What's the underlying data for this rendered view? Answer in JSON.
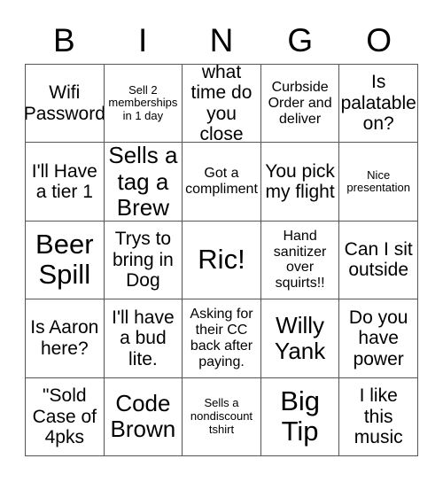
{
  "card": {
    "header_letters": [
      "B",
      "I",
      "N",
      "G",
      "O"
    ],
    "columns": 5,
    "rows": 5,
    "colors": {
      "background": "#ffffff",
      "text": "#000000",
      "grid_line": "#555555"
    },
    "cells": [
      {
        "text": "Wifi Password",
        "size": "md"
      },
      {
        "text": "Sell 2 memberships in 1 day",
        "size": "xs"
      },
      {
        "text": "what time do you close",
        "size": "md"
      },
      {
        "text": "Curbside Order and deliver",
        "size": "sm"
      },
      {
        "text": "Is palatable on?",
        "size": "md"
      },
      {
        "text": "I'll Have a tier 1",
        "size": "md"
      },
      {
        "text": "Sells a tag a Brew",
        "size": "lg"
      },
      {
        "text": "Got a compliment",
        "size": "sm"
      },
      {
        "text": "You pick my flight",
        "size": "md"
      },
      {
        "text": "Nice presentation",
        "size": "xs"
      },
      {
        "text": "Beer Spill",
        "size": "xl"
      },
      {
        "text": "Trys to bring in Dog",
        "size": "md"
      },
      {
        "text": "Ric!",
        "size": "xl"
      },
      {
        "text": "Hand sanitizer over squirts!!",
        "size": "sm"
      },
      {
        "text": "Can I sit outside",
        "size": "md"
      },
      {
        "text": "Is Aaron here?",
        "size": "md"
      },
      {
        "text": "I'll have a bud lite.",
        "size": "md"
      },
      {
        "text": "Asking for their CC back after paying.",
        "size": "sm"
      },
      {
        "text": "Willy Yank",
        "size": "lg"
      },
      {
        "text": "Do you have power",
        "size": "md"
      },
      {
        "text": "\"Sold Case of 4pks",
        "size": "md"
      },
      {
        "text": "Code Brown",
        "size": "lg"
      },
      {
        "text": "Sells a nondiscount tshirt",
        "size": "xs"
      },
      {
        "text": "Big Tip",
        "size": "xl"
      },
      {
        "text": "I like this music",
        "size": "md"
      }
    ]
  }
}
